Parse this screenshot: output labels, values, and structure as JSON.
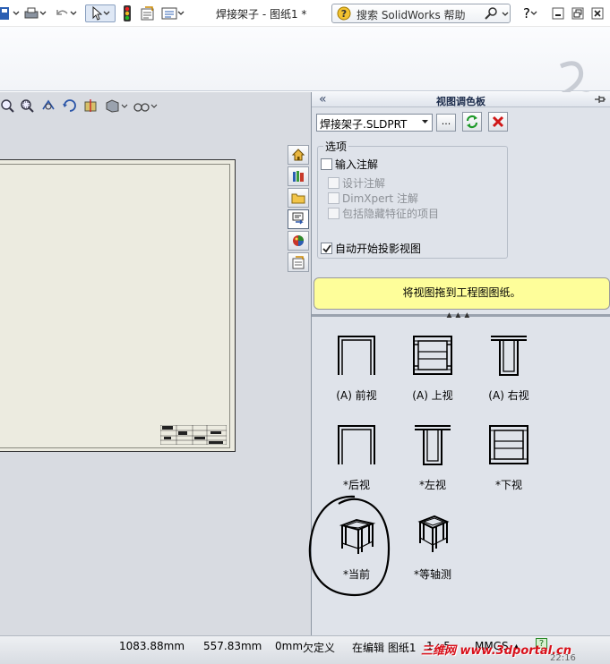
{
  "window": {
    "title": "焊接架子 - 图纸1 *",
    "search_placeholder": "搜索 SolidWorks 帮助"
  },
  "view_palette": {
    "title": "视图调色板",
    "collapse": "«",
    "file_name": "焊接架子.SLDPRT",
    "browse_label": "...",
    "options_label": "选项",
    "options": [
      {
        "label": "输入注解",
        "checked": false,
        "enabled": true
      },
      {
        "label": "设计注解",
        "checked": false,
        "enabled": false
      },
      {
        "label": "DimXpert 注解",
        "checked": false,
        "enabled": false
      },
      {
        "label": "包括隐藏特征的项目",
        "checked": false,
        "enabled": false
      },
      {
        "label": "自动开始投影视图",
        "checked": true,
        "enabled": true
      }
    ],
    "hint": "将视图拖到工程图图纸。",
    "views": [
      {
        "label": "(A) 前视",
        "icon": "front-view-icon"
      },
      {
        "label": "(A) 上视",
        "icon": "top-view-icon"
      },
      {
        "label": "(A) 右视",
        "icon": "right-view-icon"
      },
      {
        "label": "*后视",
        "icon": "back-view-icon"
      },
      {
        "label": "*左视",
        "icon": "left-view-icon"
      },
      {
        "label": "*下视",
        "icon": "bottom-view-icon"
      },
      {
        "label": "*当前",
        "icon": "current-view-icon"
      },
      {
        "label": "*等轴测",
        "icon": "isometric-view-icon"
      }
    ]
  },
  "status": {
    "x": "1083.88mm",
    "y": "557.83mm",
    "z": "0mm",
    "definition": "欠定义",
    "editing": "在编辑 图纸1",
    "scale": "1 : 5",
    "units": "MMGS",
    "units_arrow": "▴",
    "help": "?"
  },
  "watermark": "三维网 www.3dportal.cn",
  "clock": "22:16",
  "colors": {
    "hint_bg": "#fefe9a",
    "panel_bg": "#dfe3ea",
    "sheet_bg": "#ecebe0",
    "watermark": "#d8101a"
  }
}
